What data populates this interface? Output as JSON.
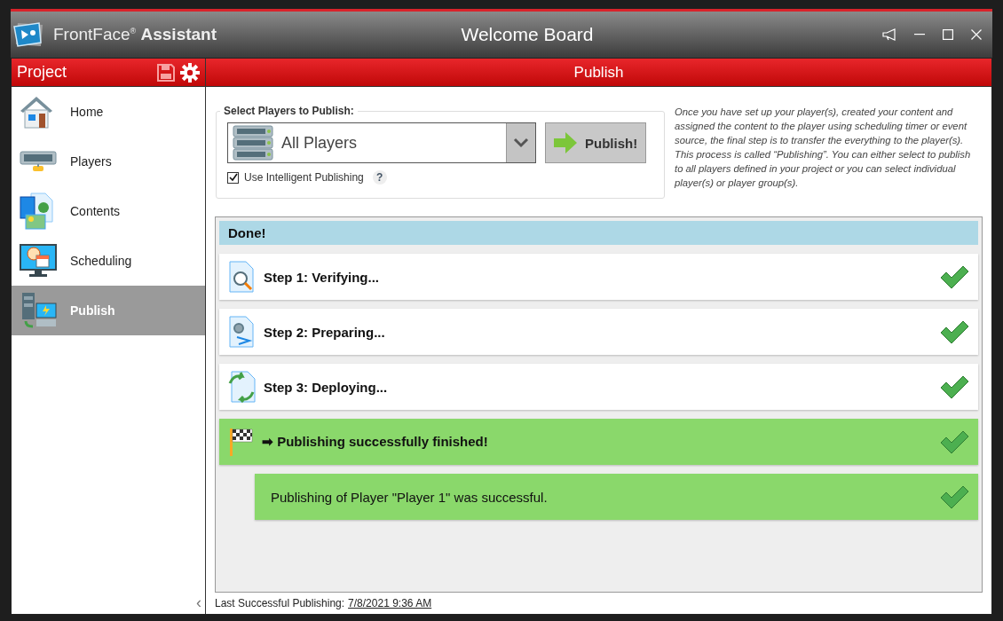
{
  "app": {
    "name": "FrontFace$^{®}$ **Assistant**"
  },
  "window": {
    "title": "Welcome Board"
  },
  "sidebar": {
    "title": "Project",
    "collapse": "‹",
    "items": [
      {
        "label": "Home",
        "kind": "home",
        "selected": false
      },
      {
        "label": "Players",
        "kind": "players",
        "selected": false
      },
      {
        "label": "Contents",
        "kind": "contents",
        "selected": false
      },
      {
        "label": "Scheduling",
        "kind": "scheduling",
        "selected": false
      },
      {
        "label": "Publish",
        "kind": "publish",
        "selected": true
      }
    ]
  },
  "panel": {
    "title": "Publish"
  },
  "publish_box": {
    "legend": "Select Players to Publish:",
    "player_select": {
      "value": "All Players"
    },
    "publish_button": "Publish!",
    "intelligent_publishing": {
      "label": "Use Intelligent Publishing",
      "checked": true
    },
    "help": "?"
  },
  "description": "Once you have set up your player(s), created your content and assigned the content to the player using scheduling timer or event source, the final step is to transfer the everything to the player(s). This process is called “Publishing”. You can either select to publish to all players defined in your project or you can select individual player(s) or player group(s).",
  "log": {
    "status": "Done!",
    "rows": [
      {
        "kind": "verify",
        "label": "Step 1: Verifying...",
        "done": true
      },
      {
        "kind": "prepare",
        "label": "Step 2: Preparing...",
        "done": true
      },
      {
        "kind": "deploy",
        "label": "Step 3: Deploying...",
        "done": true
      },
      {
        "kind": "result",
        "label": "➡ Publishing successfully finished!",
        "done": true
      },
      {
        "kind": "message",
        "label": "Publishing of Player \"Player 1\" was successful.",
        "done": true
      }
    ]
  },
  "footer": {
    "label": "Last Successful Publishing:",
    "date": "7/8/2021 9:36 AM"
  }
}
